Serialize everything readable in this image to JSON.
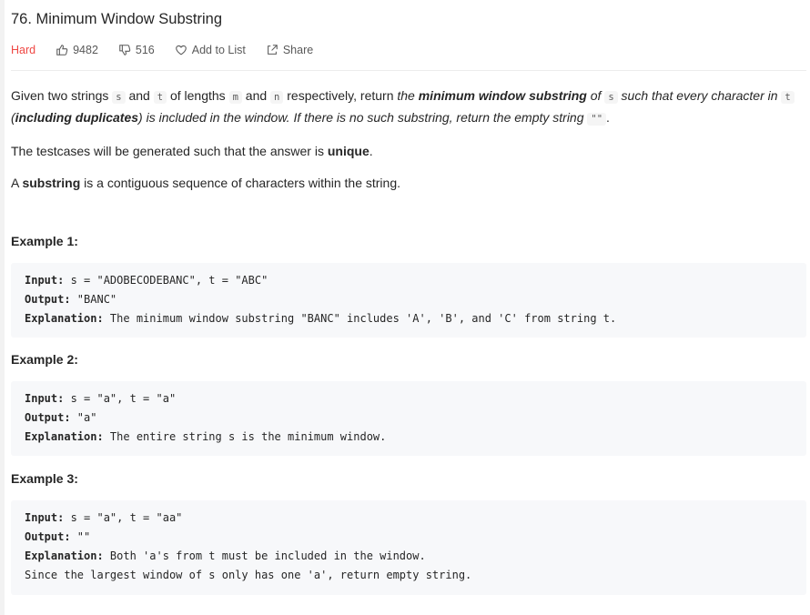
{
  "problem": {
    "title": "76. Minimum Window Substring",
    "difficulty": "Hard",
    "likes": "9482",
    "dislikes": "516",
    "add_to_list": "Add to List",
    "share": "Share"
  },
  "description": {
    "p1": {
      "t1": "Given two strings ",
      "c1": "s",
      "t2": " and ",
      "c2": "t",
      "t3": " of lengths ",
      "c3": "m",
      "t4": " and ",
      "c4": "n",
      "t5": " respectively, return ",
      "i1": "the ",
      "b1": "minimum window substring",
      "i2": " of ",
      "c5": "s",
      "i3": " such that every character in ",
      "c6": "t",
      "i4": " (",
      "b2": "including duplicates",
      "i5": ") is included in the window. If there is no such substring, return the empty string ",
      "c7": "\"\"",
      "t6": "."
    },
    "p2": {
      "t1": "The testcases will be generated such that the answer is ",
      "b1": "unique",
      "t2": "."
    },
    "p3": {
      "t1": "A ",
      "b1": "substring",
      "t2": " is a contiguous sequence of characters within the string."
    }
  },
  "examples": [
    {
      "title": "Example 1:",
      "input_label": "Input:",
      "input": " s = \"ADOBECODEBANC\", t = \"ABC\"",
      "output_label": "Output:",
      "output": " \"BANC\"",
      "explanation_label": "Explanation:",
      "explanation": " The minimum window substring \"BANC\" includes 'A', 'B', and 'C' from string t."
    },
    {
      "title": "Example 2:",
      "input_label": "Input:",
      "input": " s = \"a\", t = \"a\"",
      "output_label": "Output:",
      "output": " \"a\"",
      "explanation_label": "Explanation:",
      "explanation": " The entire string s is the minimum window."
    },
    {
      "title": "Example 3:",
      "input_label": "Input:",
      "input": " s = \"a\", t = \"aa\"",
      "output_label": "Output:",
      "output": " \"\"",
      "explanation_label": "Explanation:",
      "explanation": " Both 'a's from t must be included in the window.",
      "explanation_cont": "Since the largest window of s only has one 'a', return empty string."
    }
  ],
  "colors": {
    "difficulty_hard": "#ef4743",
    "code_bg": "#f7f8fa"
  },
  "icons": [
    "thumb-up-icon",
    "thumb-down-icon",
    "heart-icon",
    "share-icon"
  ]
}
